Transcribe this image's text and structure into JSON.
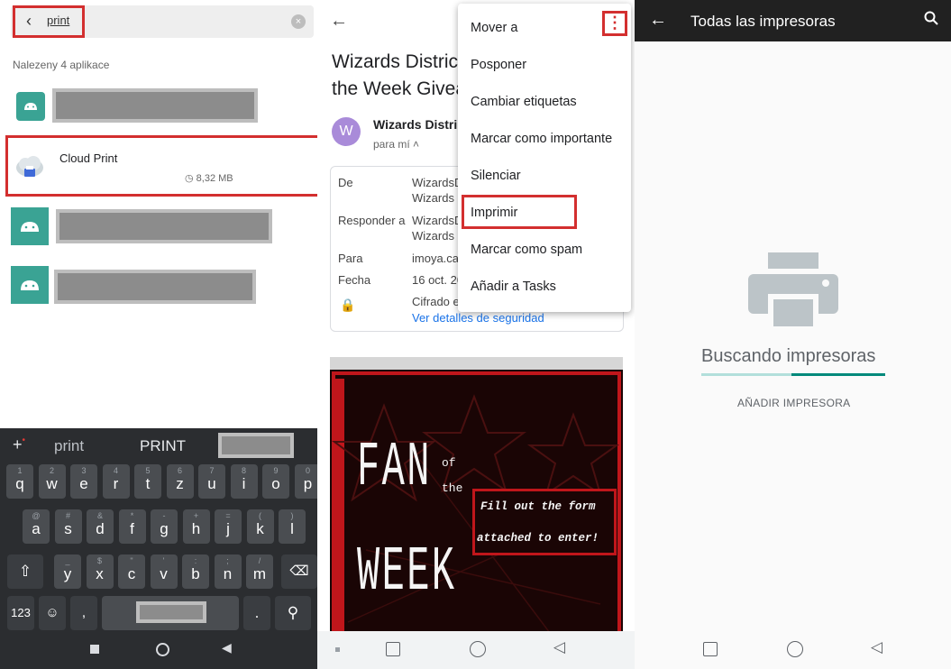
{
  "panel1": {
    "search": {
      "value": "print"
    },
    "found_text": "Nalezeny 4 aplikace",
    "apps": [
      {
        "icon": "android-icon"
      },
      {
        "name": "Cloud Print",
        "size": "8,32 MB",
        "icon": "cloud-print-icon"
      },
      {
        "icon": "android-icon"
      },
      {
        "icon": "android-icon"
      }
    ],
    "keyboard": {
      "suggestions": [
        "print",
        "PRINT"
      ],
      "rows": [
        [
          [
            "q",
            "1"
          ],
          [
            "w",
            "2"
          ],
          [
            "e",
            "3"
          ],
          [
            "r",
            "4"
          ],
          [
            "t",
            "5"
          ],
          [
            "z",
            "6"
          ],
          [
            "u",
            "7"
          ],
          [
            "i",
            "8"
          ],
          [
            "o",
            "9"
          ],
          [
            "p",
            "0"
          ]
        ],
        [
          [
            "a",
            "@"
          ],
          [
            "s",
            "#"
          ],
          [
            "d",
            "&"
          ],
          [
            "f",
            "*"
          ],
          [
            "g",
            "-"
          ],
          [
            "h",
            "+"
          ],
          [
            "j",
            "="
          ],
          [
            "k",
            "("
          ],
          [
            "l",
            ")"
          ]
        ],
        [
          [
            "y",
            "_"
          ],
          [
            "x",
            "$"
          ],
          [
            "c",
            "\""
          ],
          [
            "v",
            "'"
          ],
          [
            "b",
            ":"
          ],
          [
            "n",
            ";"
          ],
          [
            "m",
            "/"
          ]
        ]
      ],
      "numbers_key": "123"
    }
  },
  "panel2": {
    "subject_line1": "Wizards Distric",
    "subject_line2": "the Week Givea",
    "avatar_letter": "W",
    "sender": "Wizards Distri",
    "to_me": "para mí",
    "details": [
      {
        "label": "De",
        "value1": "WizardsD",
        "value2": "Wizards I"
      },
      {
        "label": "Responder a",
        "value1": "WizardsD",
        "value2": "Wizards I"
      },
      {
        "label": "Para",
        "value1": "imoya.ca"
      },
      {
        "label": "Fecha",
        "value1": "16 oct. 20"
      }
    ],
    "encrypted": "Cifrado e",
    "security_link": "Ver detalles de seguridad",
    "poster": {
      "fan": "FAN",
      "of": "of",
      "the": "the",
      "week": "WEEK",
      "fill1": "Fill out the form",
      "fill2": "attached to enter!"
    },
    "menu": [
      "Mover a",
      "Posponer",
      "Cambiar etiquetas",
      "Marcar como importante",
      "Silenciar",
      "Imprimir",
      "Marcar como spam",
      "Añadir a Tasks"
    ]
  },
  "panel3": {
    "title": "Todas las impresoras",
    "searching": "Buscando impresoras",
    "add_printer": "AÑADIR IMPRESORA"
  },
  "colors": {
    "highlight": "#d32f2f",
    "link": "#1a73e8",
    "teal": "#00897b",
    "dark": "#212121"
  }
}
